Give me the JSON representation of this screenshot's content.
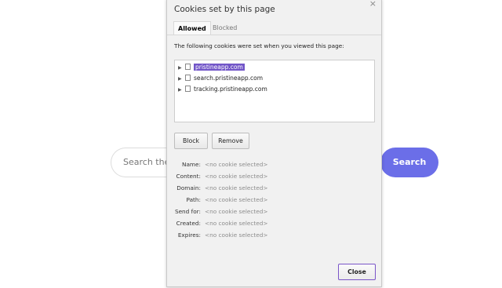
{
  "background": {
    "search_placeholder": "Search the w",
    "search_button": "Search"
  },
  "dialog": {
    "title": "Cookies set by this page",
    "close_symbol": "×",
    "tabs": [
      {
        "label": "Allowed",
        "active": true
      },
      {
        "label": "Blocked",
        "active": false
      }
    ],
    "intro": "The following cookies were set when you viewed this page:",
    "cookies": [
      {
        "domain": "pristineapp.com",
        "selected": true
      },
      {
        "domain": "search.pristineapp.com",
        "selected": false
      },
      {
        "domain": "tracking.pristineapp.com",
        "selected": false
      }
    ],
    "block_label": "Block",
    "remove_label": "Remove",
    "details": [
      {
        "key": "Name:",
        "value": "<no cookie selected>"
      },
      {
        "key": "Content:",
        "value": "<no cookie selected>"
      },
      {
        "key": "Domain:",
        "value": "<no cookie selected>"
      },
      {
        "key": "Path:",
        "value": "<no cookie selected>"
      },
      {
        "key": "Send for:",
        "value": "<no cookie selected>"
      },
      {
        "key": "Created:",
        "value": "<no cookie selected>"
      },
      {
        "key": "Expires:",
        "value": "<no cookie selected>"
      }
    ],
    "close_label": "Close"
  },
  "colors": {
    "accent": "#6b6ee8",
    "selection": "#7256c8"
  }
}
